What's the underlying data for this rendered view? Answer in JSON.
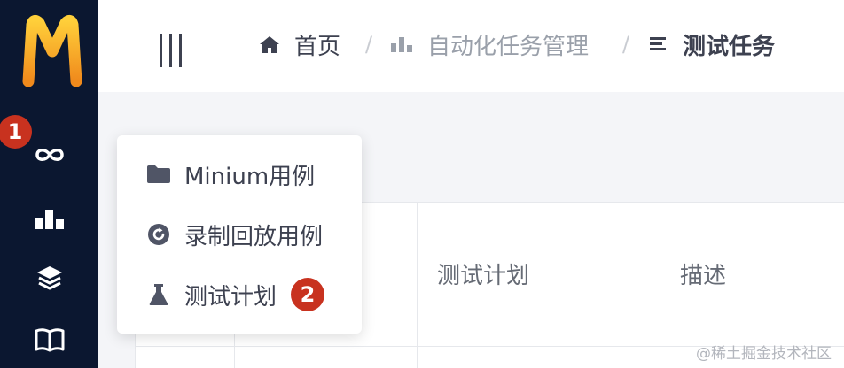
{
  "sidebar": {
    "logo_letter": "M",
    "items": [
      {
        "icon": "infinity-icon"
      },
      {
        "icon": "bar-chart-icon"
      },
      {
        "icon": "layers-icon"
      },
      {
        "icon": "book-icon"
      }
    ],
    "step_badge": "1"
  },
  "header": {
    "breadcrumb": [
      {
        "label": "首页",
        "icon": "home-icon"
      },
      {
        "label": "自动化任务管理",
        "icon": "bar-chart-icon"
      },
      {
        "label": "测试任务",
        "icon": "list-icon"
      }
    ],
    "separator": "/"
  },
  "table": {
    "columns": [
      "测试计划",
      "描述"
    ]
  },
  "menu": {
    "items": [
      {
        "label": "Minium用例",
        "icon": "folder-icon"
      },
      {
        "label": "录制回放用例",
        "icon": "replay-icon"
      },
      {
        "label": "测试计划",
        "icon": "flask-icon"
      }
    ],
    "step_badge": "2"
  },
  "watermark": "@稀土掘金技术社区",
  "colors": {
    "sidebar_bg": "#0b1730",
    "badge": "#c8321f",
    "logo": "#f5a623"
  }
}
